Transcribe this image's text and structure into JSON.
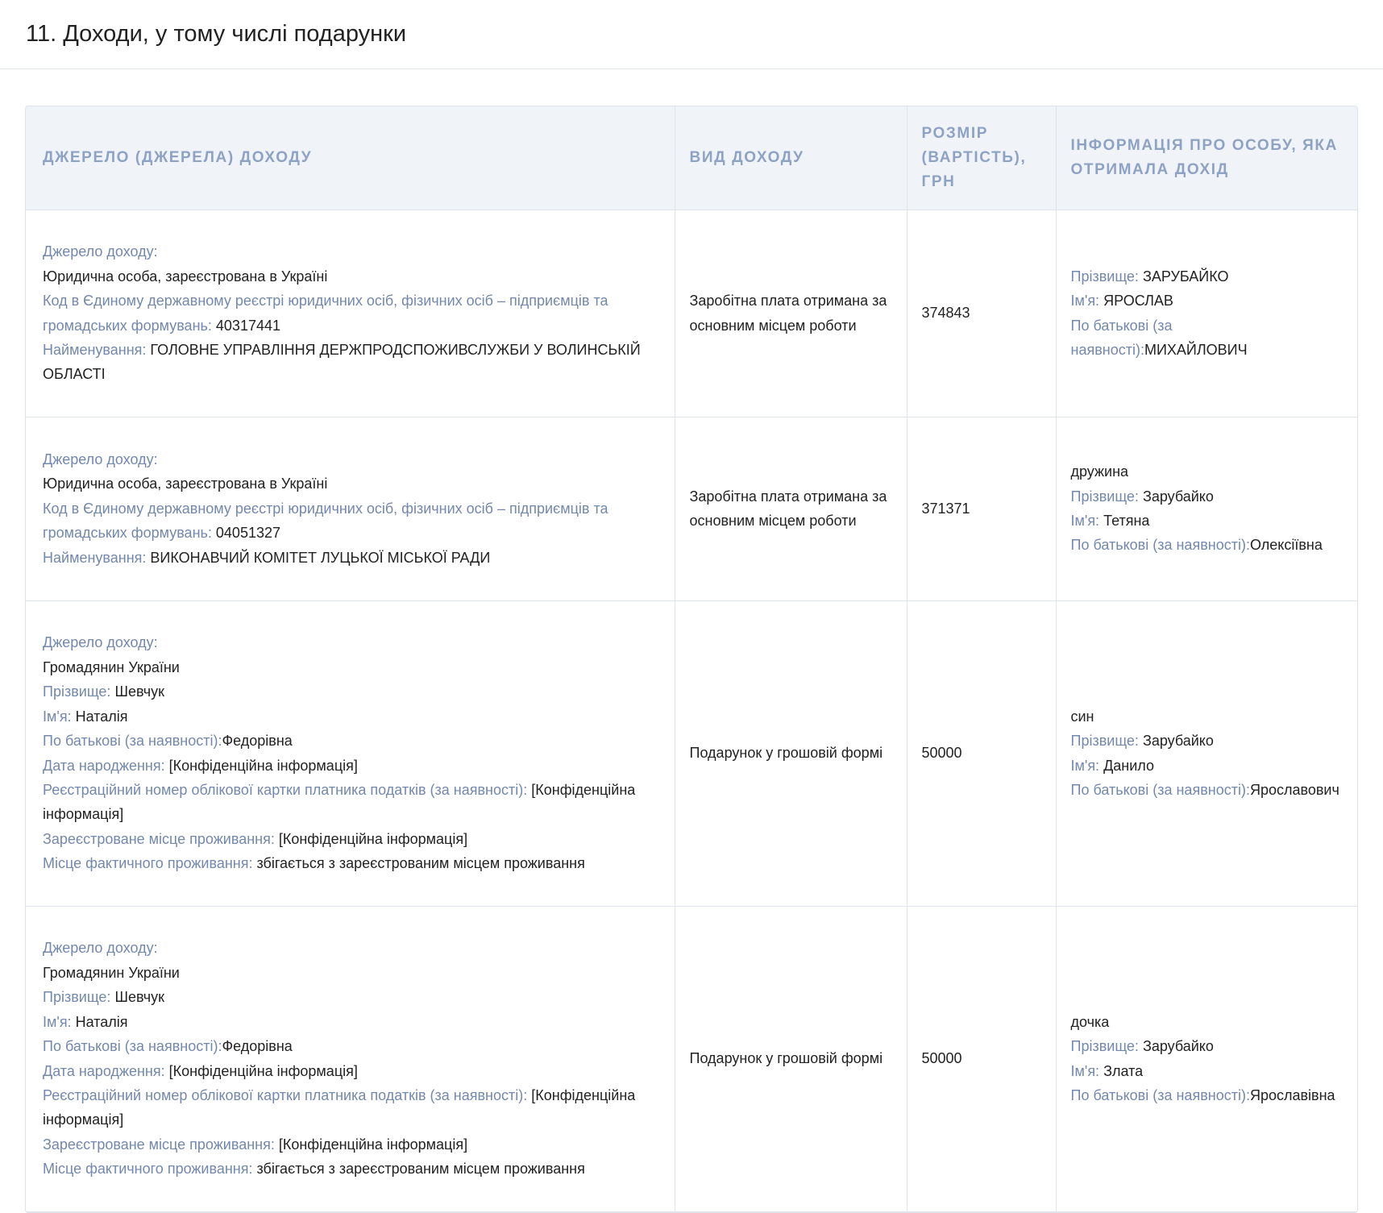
{
  "section": {
    "title": "11. Доходи, у тому числі подарунки"
  },
  "table": {
    "headers": [
      "Джерело (джерела) доходу",
      "Вид доходу",
      "Розмір (вартість), грн",
      "Інформація про особу, яка отримала дохід"
    ],
    "rows": [
      {
        "source": {
          "label_source": "Джерело доходу:",
          "type": "Юридична особа, зареєстрована в Україні",
          "label_code": "Код в Єдиному державному реєстрі юридичних осіб, фізичних осіб – підприємців та громадських формувань:",
          "code": "40317441",
          "label_name": "Найменування:",
          "name": "ГОЛОВНЕ УПРАВЛІННЯ ДЕРЖПРОДСПОЖИВСЛУЖБИ У ВОЛИНСЬКІЙ ОБЛАСТІ"
        },
        "income_type": "Заробітна плата отримана за основним місцем роботи",
        "amount": "374843",
        "recipient": {
          "relation": "",
          "label_surname": "Прізвище:",
          "surname": "ЗАРУБАЙКО",
          "label_name": "Ім'я:",
          "name": "ЯРОСЛАВ",
          "label_patronymic": "По батькові (за наявності):",
          "patronymic": "МИХАЙЛОВИЧ"
        }
      },
      {
        "source": {
          "label_source": "Джерело доходу:",
          "type": "Юридична особа, зареєстрована в Україні",
          "label_code": "Код в Єдиному державному реєстрі юридичних осіб, фізичних осіб – підприємців та громадських формувань:",
          "code": "04051327",
          "label_name": "Найменування:",
          "name": "ВИКОНАВЧИЙ КОМІТЕТ ЛУЦЬКОЇ МІСЬКОЇ РАДИ"
        },
        "income_type": "Заробітна плата отримана за основним місцем роботи",
        "amount": "371371",
        "recipient": {
          "relation": "дружина",
          "label_surname": "Прізвище:",
          "surname": "Зарубайко",
          "label_name": "Ім'я:",
          "name": "Тетяна",
          "label_patronymic": "По батькові (за наявності):",
          "patronymic": "Олексіївна"
        }
      },
      {
        "source": {
          "label_source": "Джерело доходу:",
          "type": "Громадянин України",
          "label_surname": "Прізвище:",
          "surname": "Шевчук",
          "label_first": "Ім'я:",
          "first": "Наталія",
          "label_patronymic": "По батькові (за наявності):",
          "patronymic": "Федорівна",
          "label_birth": "Дата народження:",
          "birth": "[Конфіденційна інформація]",
          "label_tax": "Реєстраційний номер облікової картки платника податків (за наявності):",
          "tax": "[Конфіденційна інформація]",
          "label_reg": "Зареєстроване місце проживання:",
          "reg": "[Конфіденційна інформація]",
          "label_actual": "Місце фактичного проживання:",
          "actual": "збігається з зареєстрованим місцем проживання"
        },
        "income_type": "Подарунок у грошовій формі",
        "amount": "50000",
        "recipient": {
          "relation": "син",
          "label_surname": "Прізвище:",
          "surname": "Зарубайко",
          "label_name": "Ім'я:",
          "name": "Данило",
          "label_patronymic": "По батькові (за наявності):",
          "patronymic": "Ярославович"
        }
      },
      {
        "source": {
          "label_source": "Джерело доходу:",
          "type": "Громадянин України",
          "label_surname": "Прізвище:",
          "surname": "Шевчук",
          "label_first": "Ім'я:",
          "first": "Наталія",
          "label_patronymic": "По батькові (за наявності):",
          "patronymic": "Федорівна",
          "label_birth": "Дата народження:",
          "birth": "[Конфіденційна інформація]",
          "label_tax": "Реєстраційний номер облікової картки платника податків (за наявності):",
          "tax": "[Конфіденційна інформація]",
          "label_reg": "Зареєстроване місце проживання:",
          "reg": "[Конфіденційна інформація]",
          "label_actual": "Місце фактичного проживання:",
          "actual": "збігається з зареєстрованим місцем проживання"
        },
        "income_type": "Подарунок у грошовій формі",
        "amount": "50000",
        "recipient": {
          "relation": "дочка",
          "label_surname": "Прізвище:",
          "surname": "Зарубайко",
          "label_name": "Ім'я:",
          "name": "Злата",
          "label_patronymic": "По батькові (за наявності):",
          "patronymic": "Ярославівна"
        }
      }
    ]
  }
}
